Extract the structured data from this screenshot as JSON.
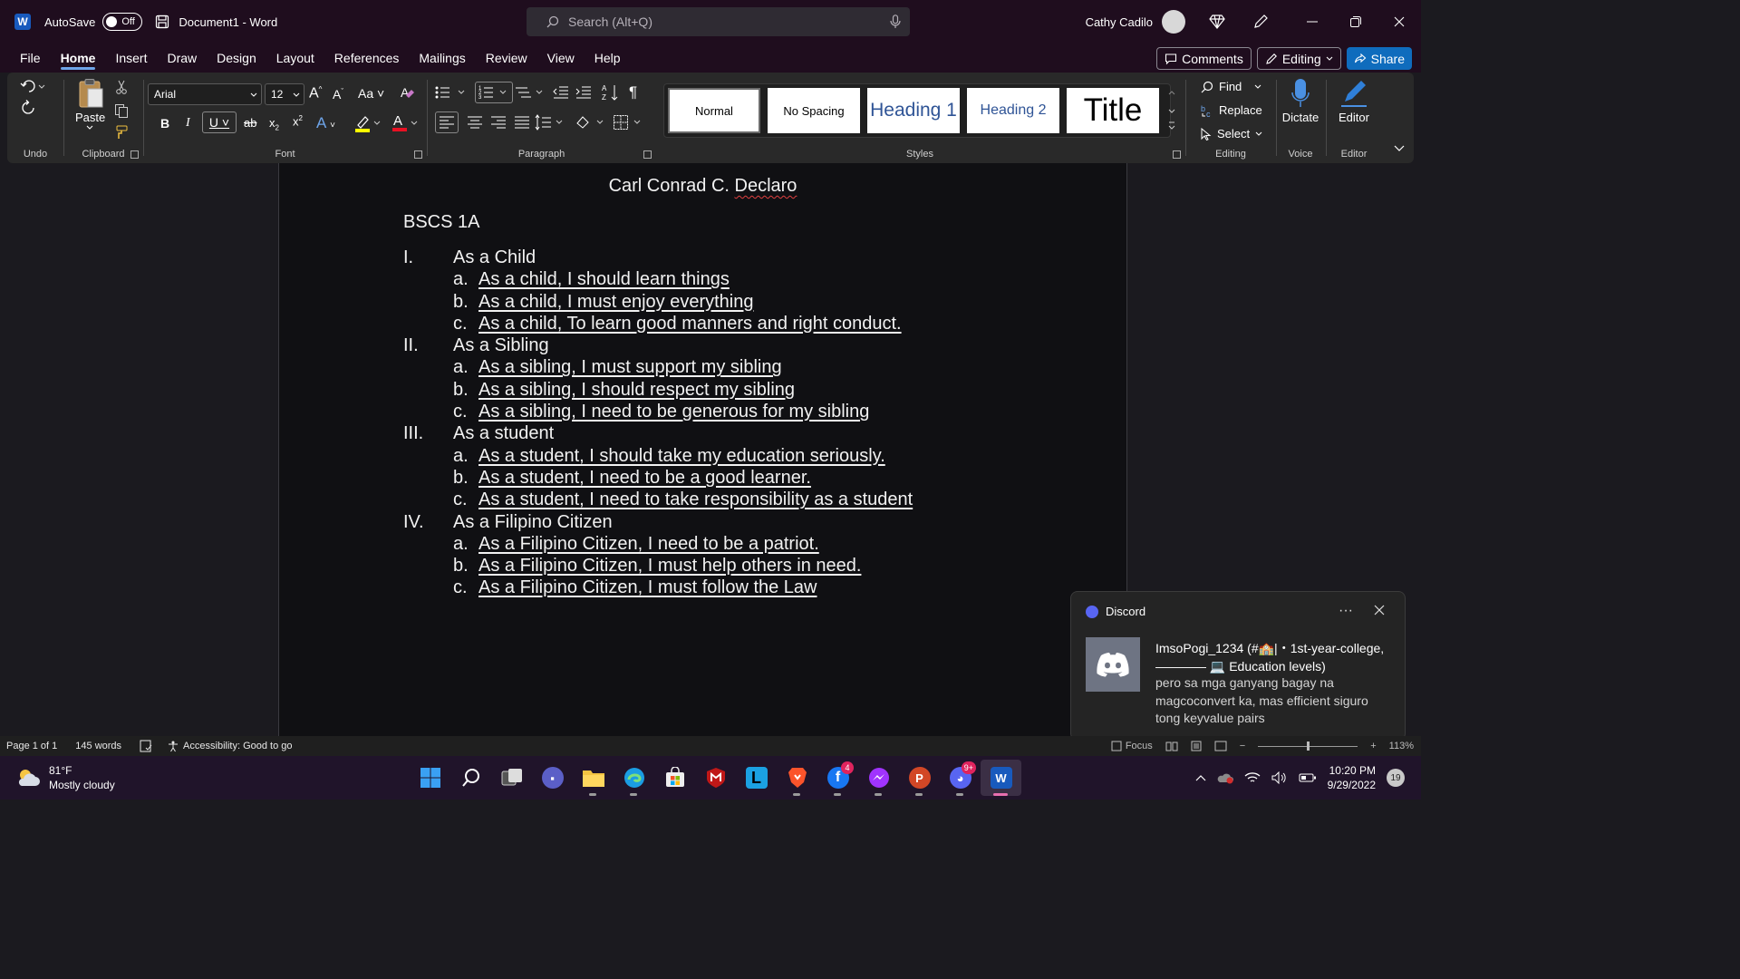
{
  "titlebar": {
    "autosave_label": "AutoSave",
    "autosave_state": "Off",
    "document_title": "Document1  -  Word",
    "search_placeholder": "Search (Alt+Q)",
    "user_name": "Cathy Cadilo"
  },
  "menu": {
    "tabs": [
      "File",
      "Home",
      "Insert",
      "Draw",
      "Design",
      "Layout",
      "References",
      "Mailings",
      "Review",
      "View",
      "Help"
    ],
    "active_tab": "Home",
    "comments_label": "Comments",
    "editing_label": "Editing",
    "share_label": "Share"
  },
  "ribbon": {
    "groups": {
      "undo": "Undo",
      "clipboard": "Clipboard",
      "font": "Font",
      "paragraph": "Paragraph",
      "styles": "Styles",
      "editing": "Editing",
      "voice": "Voice",
      "editor": "Editor"
    },
    "paste_label": "Paste",
    "font_name": "Arial",
    "font_size": "12",
    "styles": [
      "Normal",
      "No Spacing",
      "Heading 1",
      "Heading 2",
      "Title"
    ],
    "find_label": "Find",
    "replace_label": "Replace",
    "select_label": "Select",
    "dictate_label": "Dictate",
    "editor_label": "Editor",
    "highlight_color": "#ffff00",
    "font_color": "#e81123"
  },
  "document": {
    "author": "Carl Conrad C. Declaro",
    "section": "BSCS 1A",
    "outline": [
      {
        "num": "I.",
        "title": "As a Child",
        "items": [
          {
            "num": "a.",
            "text": "As a child, I should learn things"
          },
          {
            "num": "b.",
            "text": "As a child, I must enjoy everything"
          },
          {
            "num": "c.",
            "text": "As a child, To learn good manners and right conduct."
          }
        ]
      },
      {
        "num": "II.",
        "title": "As a Sibling",
        "items": [
          {
            "num": "a.",
            "text": "As a sibling, I must support my sibling"
          },
          {
            "num": "b.",
            "text": "As a sibling, I should respect my sibling"
          },
          {
            "num": "c.",
            "text": "As a sibling, I need to be generous for my sibling"
          }
        ]
      },
      {
        "num": "III.",
        "title": "As a student",
        "items": [
          {
            "num": "a.",
            "text": "As a student, I should take my education seriously."
          },
          {
            "num": "b.",
            "text": "As a student, I need to be a good learner."
          },
          {
            "num": "c.",
            "text": "As a student, I need to take responsibility as a student"
          }
        ]
      },
      {
        "num": "IV.",
        "title": "As a Filipino Citizen",
        "items": [
          {
            "num": "a.",
            "text": "As a Filipino Citizen, I need to be a patriot."
          },
          {
            "num": "b.",
            "text": "As a Filipino Citizen, I must help others in need."
          },
          {
            "num": "c.",
            "text": "As a Filipino Citizen, I must follow the Law"
          }
        ]
      }
    ]
  },
  "notification": {
    "app": "Discord",
    "more": "···",
    "title": "ImsoPogi_1234 (#🏫|・1st-year-college, ———— 💻 Education levels)",
    "body": "pero sa mga ganyang bagay na magcoconvert ka, mas efficient siguro tong keyvalue pairs"
  },
  "status": {
    "page": "Page 1 of 1",
    "words": "145 words",
    "accessibility": "Accessibility: Good to go",
    "focus": "Focus",
    "zoom": "113%"
  },
  "taskbar": {
    "temperature": "81°F",
    "weather": "Mostly cloudy",
    "facebook_badge": "4",
    "discord_badge": "9+",
    "time": "10:20 PM",
    "date": "9/29/2022",
    "notification_count": "19"
  }
}
